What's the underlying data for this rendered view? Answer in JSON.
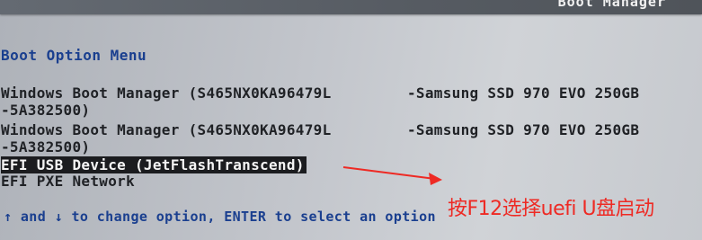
{
  "header": {
    "title": "Boot Manager"
  },
  "menu": {
    "title": "Boot Option Menu",
    "entries": [
      {
        "name": "Windows Boot Manager (S465NX0KA96479L",
        "model": "-Samsung SSD 970 EVO 250GB",
        "continuation": "-5A382500)"
      },
      {
        "name": "Windows Boot Manager (S465NX0KA96479L",
        "model": "-Samsung SSD 970 EVO 250GB",
        "continuation": "-5A382500)"
      },
      {
        "name": "EFI USB Device (JetFlashTranscend)",
        "selected": true
      },
      {
        "name": "EFI PXE Network"
      }
    ]
  },
  "footer": {
    "help": "↑ and ↓ to change option, ENTER to select an option"
  },
  "annotation": {
    "text": "按F12选择uefi U盘启动",
    "color": "#ee2a24"
  },
  "colors": {
    "title_blue": "#1a3f8f",
    "highlight_bg": "#1b1c1f",
    "text": "#202226"
  }
}
